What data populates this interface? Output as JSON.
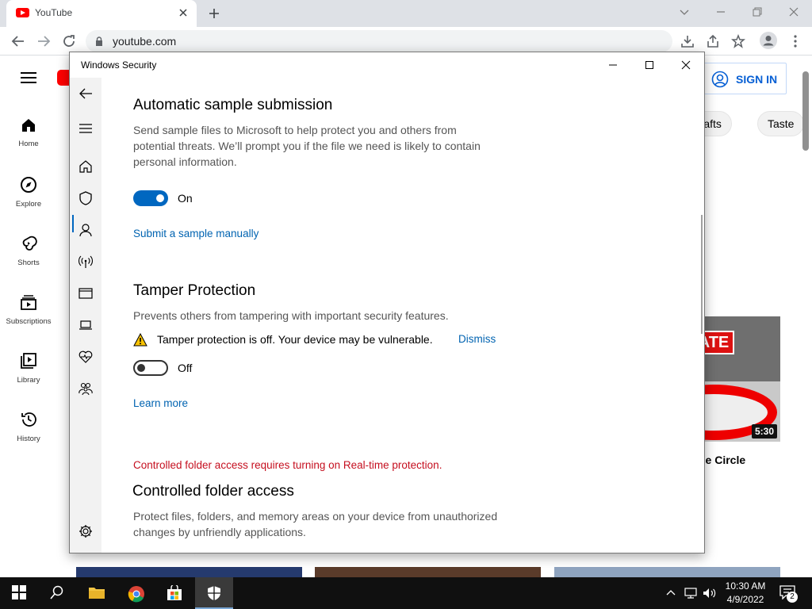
{
  "browser": {
    "tab_title": "YouTube",
    "url": "youtube.com"
  },
  "youtube": {
    "nav": [
      {
        "label": "Home",
        "icon": "home-icon"
      },
      {
        "label": "Explore",
        "icon": "compass-icon"
      },
      {
        "label": "Shorts",
        "icon": "shorts-icon"
      },
      {
        "label": "Subscriptions",
        "icon": "subscriptions-icon"
      },
      {
        "label": "Library",
        "icon": "library-icon"
      },
      {
        "label": "History",
        "icon": "history-icon"
      }
    ],
    "sign_in": "SIGN IN",
    "chips": [
      "rcrafts",
      "Taste"
    ],
    "video": {
      "badge": "ATE",
      "duration": "5:30",
      "title_fragment": "n The Circle"
    },
    "accent_color": "#ff0000",
    "link_color": "#065fd4"
  },
  "security": {
    "window_title": "Windows Security",
    "auto_sample": {
      "heading": "Automatic sample submission",
      "desc_lines": [
        "Send sample files to Microsoft to help protect you and others from",
        "potential threats. We’ll prompt you if the file we need is likely to contain",
        "personal information."
      ],
      "toggle_state": "On",
      "link": "Submit a sample manually"
    },
    "tamper": {
      "heading": "Tamper Protection",
      "desc": "Prevents others from tampering with important security features.",
      "warning": "Tamper protection is off. Your device may be vulnerable.",
      "dismiss": "Dismiss",
      "toggle_state": "Off",
      "link": "Learn more"
    },
    "cfa": {
      "note": "Controlled folder access requires turning on Real-time protection.",
      "heading": "Controlled folder access",
      "desc_lines": [
        "Protect files, folders, and memory areas on your device from unauthorized",
        "changes by unfriendly applications."
      ]
    },
    "accent_color": "#0067c0",
    "error_color": "#c50f1f"
  },
  "taskbar": {
    "time": "10:30 AM",
    "date": "4/9/2022",
    "notification_count": "2"
  }
}
